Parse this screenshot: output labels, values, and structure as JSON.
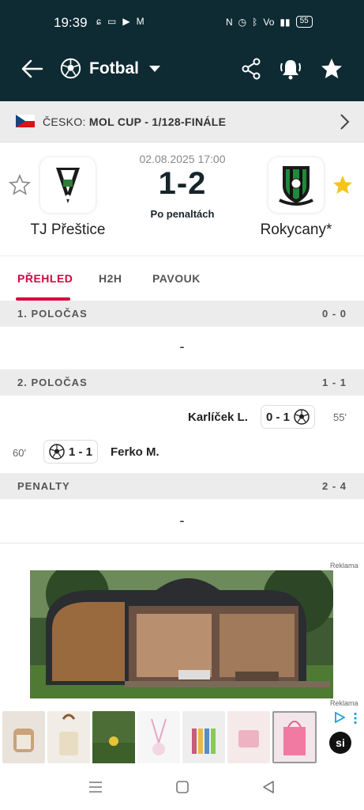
{
  "status_bar": {
    "time": "19:39",
    "battery": "55"
  },
  "app_bar": {
    "sport": "Fotbal"
  },
  "league": {
    "country": "ČESKO:",
    "competition": "MOL CUP - 1/128-FINÁLE"
  },
  "match": {
    "date": "02.08.2025 17:00",
    "score": "1-2",
    "status": "Po penaltách",
    "home_team": "TJ Přeštice",
    "away_team": "Rokycany*"
  },
  "tabs": [
    {
      "label": "PŘEHLED",
      "active": true
    },
    {
      "label": "H2H",
      "active": false
    },
    {
      "label": "PAVOUK",
      "active": false
    }
  ],
  "periods": [
    {
      "label": "1. POLOČAS",
      "score": "0 - 0",
      "empty_text": "-"
    },
    {
      "label": "2. POLOČAS",
      "score": "1 - 1"
    },
    {
      "label": "PENALTY",
      "score": "2 - 4",
      "empty_text": "-"
    }
  ],
  "events": [
    {
      "side": "away",
      "minute": "55'",
      "player": "Karlíček L.",
      "score": "0 - 1",
      "icon": "soccer-ball-icon"
    },
    {
      "side": "home",
      "minute": "60'",
      "player": "Ferko M.",
      "score": "1 - 1",
      "icon": "soccer-ball-icon"
    }
  ],
  "ads": {
    "label_1": "Reklama",
    "label_2": "Reklama",
    "brand_badge": "si"
  },
  "colors": {
    "header": "#0e2a33",
    "accent": "#d7003f",
    "star_active": "#f5c518"
  }
}
